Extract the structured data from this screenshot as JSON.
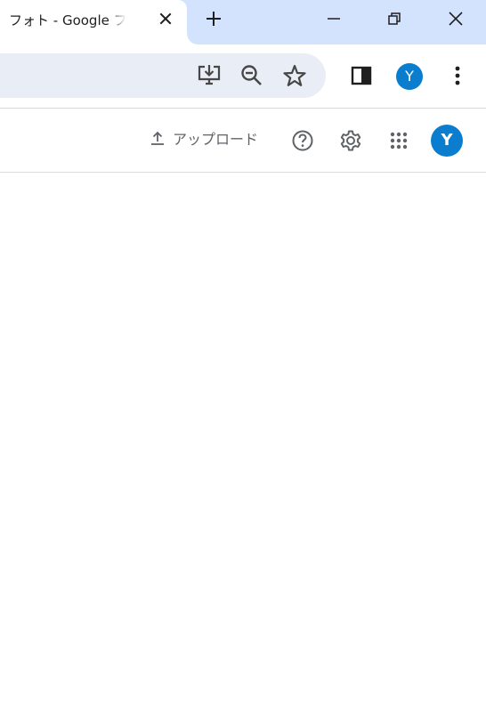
{
  "browser": {
    "tab": {
      "title": "フォト - Google フォト"
    },
    "new_tab_icon": "plus-icon",
    "window_controls": [
      "minimize-icon",
      "restore-icon",
      "close-icon"
    ],
    "profile_initial": "Y"
  },
  "toolbar": {
    "icons": [
      "install-app-icon",
      "zoom-out-icon",
      "bookmark-star-icon",
      "side-panel-icon",
      "kebab-menu-icon"
    ]
  },
  "photos_header": {
    "upload_label": "アップロード",
    "icons": [
      "help-icon",
      "settings-icon",
      "apps-grid-icon"
    ],
    "account_initial": "Y"
  },
  "colors": {
    "tabstrip_bg": "#d3e3fd",
    "omnibox_bg": "#e9eef6",
    "avatar_bg": "#0b7dcf",
    "icon_color": "#474747"
  }
}
